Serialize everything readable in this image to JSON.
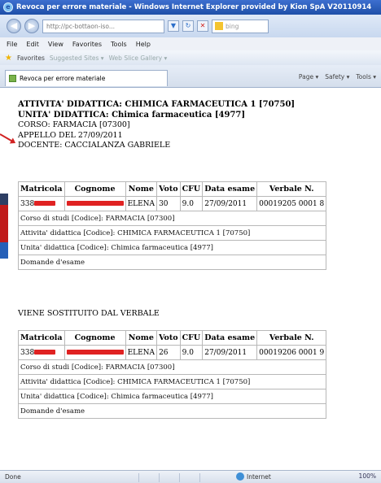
{
  "window": {
    "title": "Revoca per errore materiale - Windows Internet Explorer provided by Kion SpA V20110914",
    "logo_glyph": "e"
  },
  "addressbar": {
    "back_glyph": "◀",
    "forward_glyph": "▶",
    "url": "http://pc-bottaon-iso...",
    "dropdown_glyph": "▼",
    "refresh_glyph": "↻",
    "stop_glyph": "✕",
    "search_placeholder": "bing"
  },
  "menu": [
    "File",
    "Edit",
    "View",
    "Favorites",
    "Tools",
    "Help"
  ],
  "favorites_bar": {
    "favorites_label": "Favorites",
    "items": [
      "Suggested Sites ▾",
      "Web Slice Gallery ▾"
    ]
  },
  "tab": {
    "label": "Revoca per errore materiale"
  },
  "commandbar": [
    "Page ▾",
    "Safety ▾",
    "Tools ▾"
  ],
  "heading": {
    "line1": "ATTIVITA' DIDATTICA: CHIMICA FARMACEUTICA 1 [70750]",
    "line2": "UNITA' DIDATTICA: Chimica farmaceutica [4977]",
    "line3": "CORSO: FARMACIA [07300]",
    "line4": "APPELLO DEL 27/09/2011",
    "line5": "DOCENTE: CACCIALANZA GABRIELE"
  },
  "table_headers": [
    "Matricola",
    "Cognome",
    "Nome",
    "Voto",
    "CFU",
    "Data esame",
    "Verbale N."
  ],
  "record1": {
    "matricola": "338",
    "nome": "ELENA",
    "voto": "30",
    "cfu": "9.0",
    "data": "27/09/2011",
    "verbale": "00019205 0001 8",
    "corso": "Corso di studi [Codice]: FARMACIA [07300]",
    "attivita": "Attivita' didattica [Codice]: CHIMICA FARMACEUTICA 1 [70750]",
    "unita": "Unita' didattica [Codice]: Chimica farmaceutica [4977]",
    "domande": "Domande d'esame"
  },
  "substitution_text": "VIENE SOSTITUITO DAL VERBALE",
  "record2": {
    "matricola": "338",
    "nome": "ELENA",
    "voto": "26",
    "cfu": "9.0",
    "data": "27/09/2011",
    "verbale": "00019206 0001 9",
    "corso": "Corso di studi [Codice]: FARMACIA [07300]",
    "attivita": "Attivita' didattica [Codice]: CHIMICA FARMACEUTICA 1 [70750]",
    "unita": "Unita' didattica [Codice]: Chimica farmaceutica [4977]",
    "domande": "Domande d'esame"
  },
  "status": {
    "text": "Done",
    "zone": "Internet",
    "zoom": "100%"
  },
  "colors": {
    "redaction": "#e02222",
    "arrow": "#d12222",
    "titlebar": "#1e4fa8"
  }
}
